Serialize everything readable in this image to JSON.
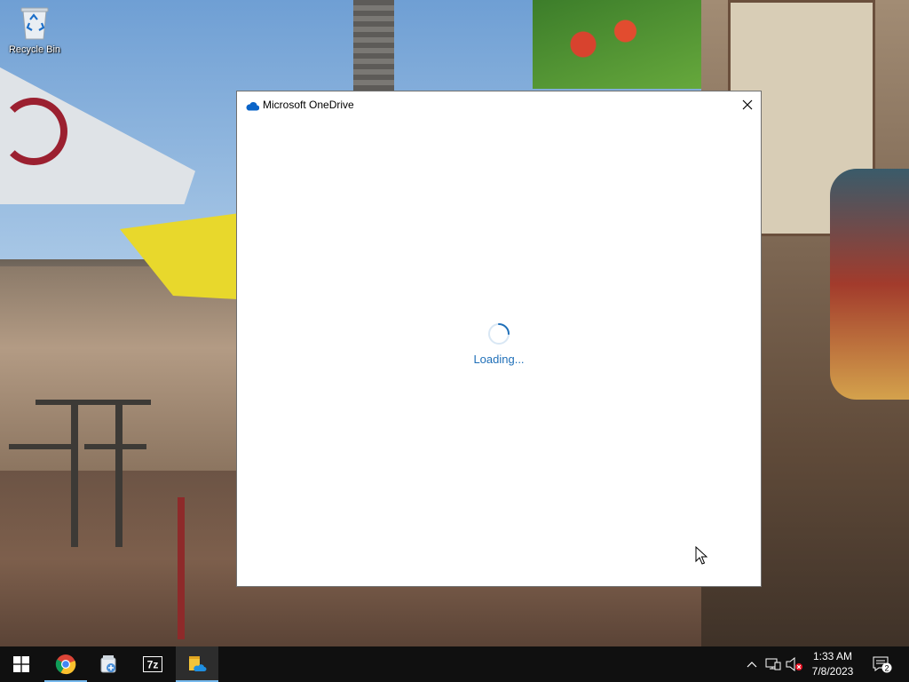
{
  "desktop": {
    "icons": [
      {
        "label": "Recycle Bin",
        "icon": "recycle-bin-icon"
      }
    ]
  },
  "window": {
    "title": "Microsoft OneDrive",
    "app_icon": "onedrive-cloud-icon",
    "close_icon": "close-icon",
    "status_text": "Loading...",
    "accent_color": "#1f6fb8"
  },
  "taskbar": {
    "start_icon": "windows-start-icon",
    "pinned": [
      {
        "name": "chrome-icon",
        "open": false
      },
      {
        "name": "control-panel-icon",
        "open": false
      },
      {
        "name": "7zip-icon",
        "label": "7z",
        "open": false
      },
      {
        "name": "file-explorer-onedrive-icon",
        "open": true
      }
    ],
    "tray": {
      "icons": [
        "show-hidden-icons-chevron-icon",
        "network-icon",
        "volume-muted-icon"
      ],
      "time": "1:33 AM",
      "date": "7/8/2023",
      "notification_count": "2"
    }
  }
}
